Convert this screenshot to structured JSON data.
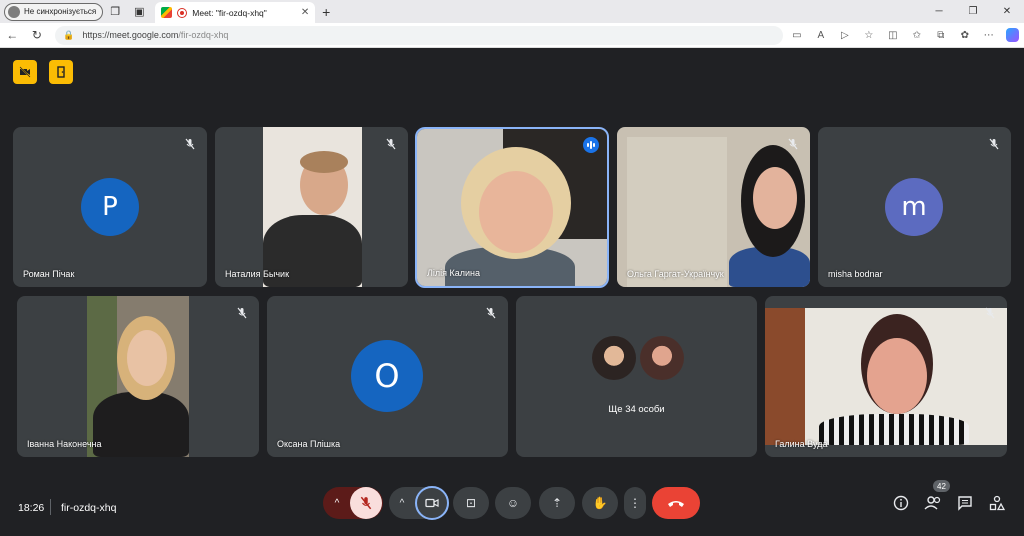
{
  "browser": {
    "profile_label": "Не синхронізується",
    "tab_title": "Meet: \"fir-ozdq-xhq\"",
    "url_host": "https://meet.google.com",
    "url_path": "/fir-ozdq-xhq"
  },
  "participants_top": [
    {
      "name": "Роман Пічак",
      "initial": "P",
      "avatar_color": "#1565c0"
    },
    {
      "name": "Наталия Бычик"
    },
    {
      "name": "Лілія Калина"
    },
    {
      "name": "Ольга Гаргат-Українчук"
    },
    {
      "name": "misha bodnar",
      "initial": "m",
      "avatar_color": "#5c6bc0"
    }
  ],
  "participants_bottom": [
    {
      "name": "Іванна Наконечна"
    },
    {
      "name": "Оксана Плішка",
      "initial": "О",
      "avatar_color": "#1565c0"
    },
    {
      "name": "Ще 34 особи"
    },
    {
      "name": "Галина Вуда"
    }
  ],
  "bottom_bar": {
    "time": "18:26",
    "meeting_code": "fir-ozdq-xhq",
    "people_count": "42"
  },
  "colors": {
    "bg": "#202124",
    "tile": "#3c4043",
    "accent": "#8ab4f8",
    "end_call": "#ea4335",
    "mic_off": "#f9dedc",
    "warning": "#fbbc04"
  }
}
